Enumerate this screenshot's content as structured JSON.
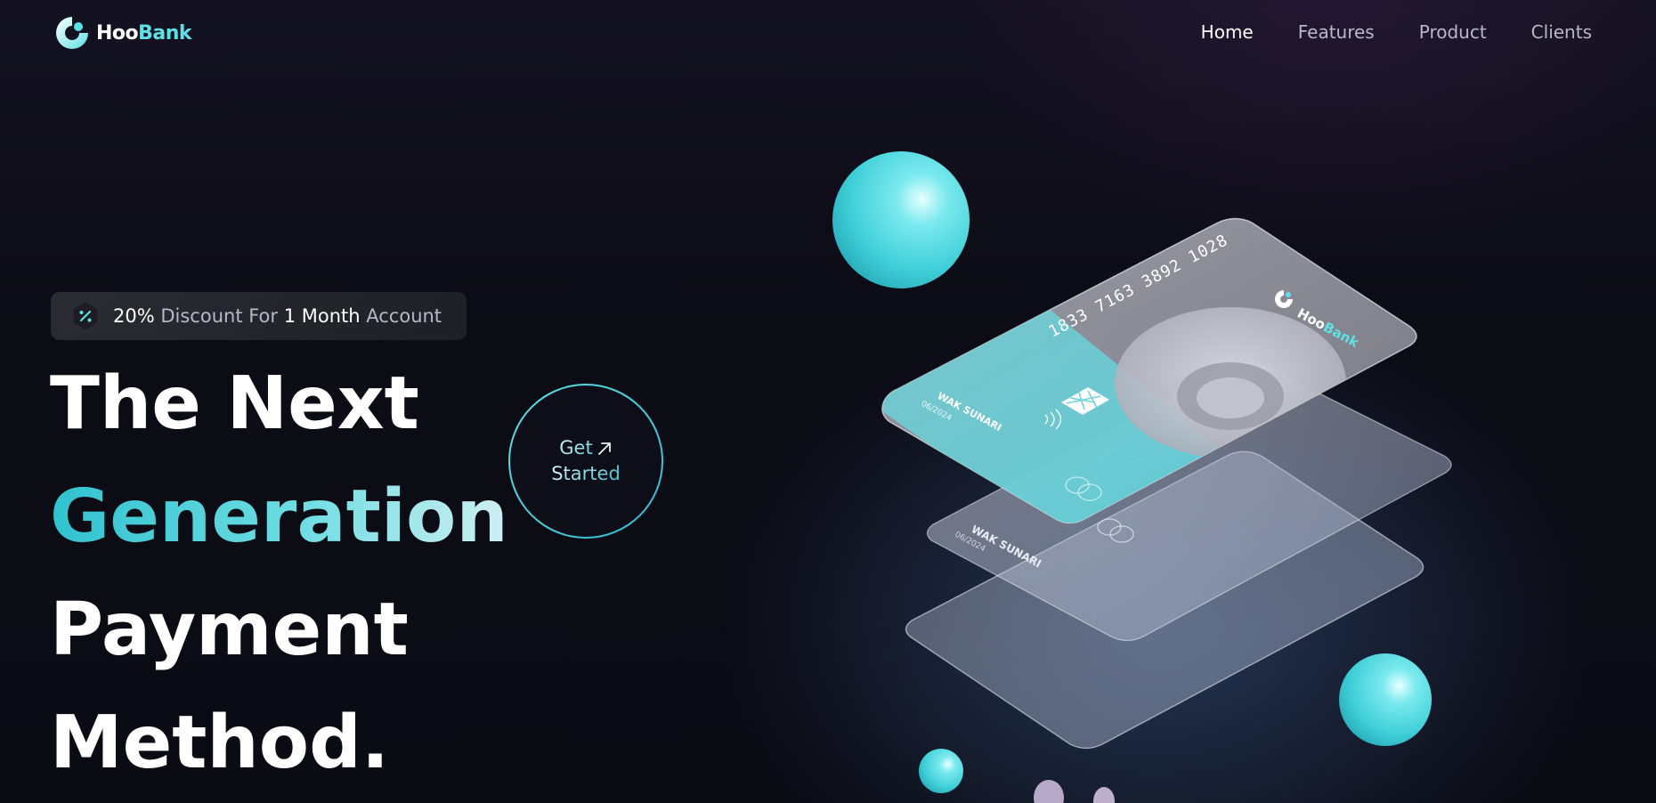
{
  "brand": {
    "name_part1": "Hoo",
    "name_part2": "Bank",
    "accent_color": "#5ce1e6",
    "logo_icon": "hoobank-logo-icon"
  },
  "nav": {
    "links": [
      {
        "label": "Home",
        "active": true
      },
      {
        "label": "Features",
        "active": false
      },
      {
        "label": "Product",
        "active": false
      },
      {
        "label": "Clients",
        "active": false
      }
    ]
  },
  "hero": {
    "badge": {
      "icon": "discount-icon",
      "part1": "20%",
      "part2": " Discount For ",
      "part3": "1 Month",
      "part4": " Account"
    },
    "headline": {
      "line1": "The Next",
      "line2": "Generation",
      "line3": "Payment",
      "line4": "Method."
    },
    "cta": {
      "line1": "Get",
      "line2": "Started",
      "icon": "arrow-up-right-icon"
    }
  },
  "card": {
    "number": "1833 7163 3892 1028",
    "holder": "WAK SUNARI",
    "expiry": "06/2024",
    "brand_part1": "Hoo",
    "brand_part2": "Bank"
  }
}
